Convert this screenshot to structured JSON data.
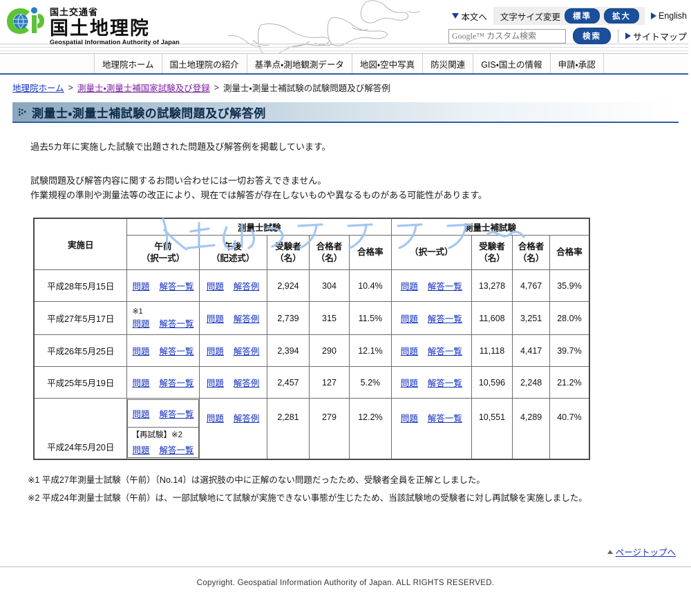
{
  "header": {
    "logo": {
      "ministry": "国土交通省",
      "main": "国土地理院",
      "english": "Geospatial Information Authority of Japan"
    },
    "utilities": {
      "skip_to_content": "本文へ",
      "font_size_label": "文字サイズ変更",
      "font_size_standard": "標準",
      "font_size_large": "拡大",
      "english": "English",
      "sitemap": "サイトマップ"
    },
    "search": {
      "placeholder": "Google™ カスタム検索",
      "value": "",
      "button": "検索"
    }
  },
  "nav": {
    "items": [
      {
        "label": "地理院ホーム"
      },
      {
        "label": "国土地理院の紹介"
      },
      {
        "label": "基準点・測地観測データ"
      },
      {
        "label": "地図・空中写真"
      },
      {
        "label": "防災関連"
      },
      {
        "label": "GIS・国土の情報"
      },
      {
        "label": "申請・承認"
      }
    ]
  },
  "breadcrumb": {
    "home": "地理院ホーム",
    "sep1": ">",
    "parent": "測量士・測量士補国家試験及び登録",
    "sep2": ">",
    "current": "測量士・測量士補試験の試験問題及び解答例"
  },
  "page_title": "測量士・測量士補試験の試験問題及び解答例",
  "body": {
    "lead": "過去5カ年に実施した試験で出題された問題及び解答例を掲載しています。",
    "notice_line1": "試験問題及び解答内容に関するお問い合わせには一切お答えできません。",
    "notice_line2": "作業規程の準則や測量法等の改正により、現在では解答が存在しないものや異なるものがある可能性があります。"
  },
  "watermark_text": "人生なんてランランラン〜",
  "table": {
    "header": {
      "date": "実施日",
      "group_surveyor": "測量士試験",
      "group_assistant": "測量士補試験",
      "morning": "午前",
      "morning_type": "（択一式）",
      "afternoon": "午後",
      "afternoon_type": "（記述式）",
      "examinees": "受験者",
      "examinees_unit": "（名）",
      "passers": "合格者",
      "passers_unit": "（名）",
      "pass_rate": "合格率",
      "assistant_type": "（択一式）"
    },
    "link_labels": {
      "question": "問題",
      "answer_list": "解答一覧",
      "answer_example": "解答例"
    },
    "rows": [
      {
        "date": "平成28年5月15日",
        "note": "",
        "s_examinees": "2,924",
        "s_passers": "304",
        "s_rate": "10.4%",
        "a_examinees": "13,278",
        "a_passers": "4,767",
        "a_rate": "35.9%",
        "retest": null
      },
      {
        "date": "平成27年5月17日",
        "note": "※1",
        "s_examinees": "2,739",
        "s_passers": "315",
        "s_rate": "11.5%",
        "a_examinees": "11,608",
        "a_passers": "3,251",
        "a_rate": "28.0%",
        "retest": null
      },
      {
        "date": "平成26年5月25日",
        "note": "",
        "s_examinees": "2,394",
        "s_passers": "290",
        "s_rate": "12.1%",
        "a_examinees": "11,118",
        "a_passers": "4,417",
        "a_rate": "39.7%",
        "retest": null
      },
      {
        "date": "平成25年5月19日",
        "note": "",
        "s_examinees": "2,457",
        "s_passers": "127",
        "s_rate": "5.2%",
        "a_examinees": "10,596",
        "a_passers": "2,248",
        "a_rate": "21.2%",
        "retest": null
      },
      {
        "date": "平成24年5月20日",
        "note": "",
        "s_examinees": "2,281",
        "s_passers": "279",
        "s_rate": "12.2%",
        "a_examinees": "10,551",
        "a_passers": "4,289",
        "a_rate": "40.7%",
        "retest": "【再試験】※2"
      }
    ]
  },
  "footnotes": {
    "note1": "※1  平成27年測量士試験（午前）〔No.14〕は選択肢の中に正解のない問題だったため、受験者全員を正解としました。",
    "note2": "※2  平成24年測量士試験（午前）は、一部試験地にて試験が実施できない事態が生じたため、当該試験地の受験者に対し再試験を実施しました。"
  },
  "pagetop": "ページトップへ",
  "copyright": "Copyright. Geospatial Information Authority of Japan. ALL RIGHTS RESERVED."
}
